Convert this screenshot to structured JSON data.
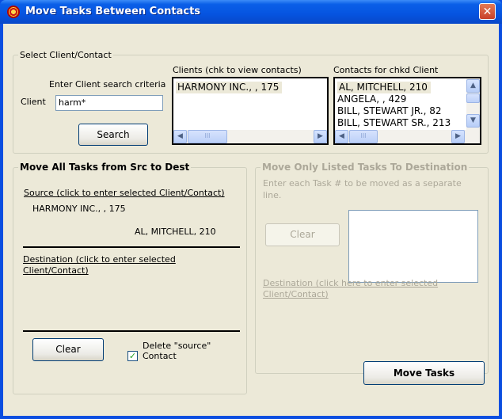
{
  "window": {
    "title": "Move Tasks Between Contacts",
    "close_label": "✕"
  },
  "select_group": {
    "legend": "Select Client/Contact",
    "search_criteria_label": "Enter Client search criteria",
    "client_label": "Client",
    "client_input_value": "harm*",
    "search_button": "Search",
    "clients_list_label": "Clients (chk to view contacts)",
    "clients": [
      "HARMONY INC., , 175"
    ],
    "contacts_list_label": "Contacts for chkd Client",
    "contacts": [
      "AL, MITCHELL, 210",
      "ANGELA, , 429",
      "BILL, STEWART JR., 82",
      "BILL, STEWART SR., 213"
    ]
  },
  "move_all": {
    "legend": "Move All Tasks from Src to Dest",
    "source_link": "Source (click to enter selected Client/Contact)",
    "source_client": "HARMONY INC., , 175",
    "source_contact": "AL, MITCHELL, 210",
    "destination_link_line1": "Destination (click to enter selected",
    "destination_link_line2": "Client/Contact)",
    "clear_button": "Clear",
    "delete_source_line1": "Delete \"source\"",
    "delete_source_line2": "Contact",
    "delete_source_checked": true
  },
  "move_listed": {
    "legend": "Move Only Listed Tasks To Destination",
    "instructions_line1": "Enter each Task # to be moved as a separate",
    "instructions_line2": "line.",
    "clear_button": "Clear",
    "destination_link_line1": "Destination (click here to enter selected",
    "destination_link_line2": "Client/Contact)"
  },
  "move_tasks_button": "Move Tasks",
  "icons": {
    "scroll_left": "◀",
    "scroll_right": "▶",
    "scroll_up": "▲",
    "scroll_down": "▼",
    "grip": "III",
    "check": "✓"
  }
}
